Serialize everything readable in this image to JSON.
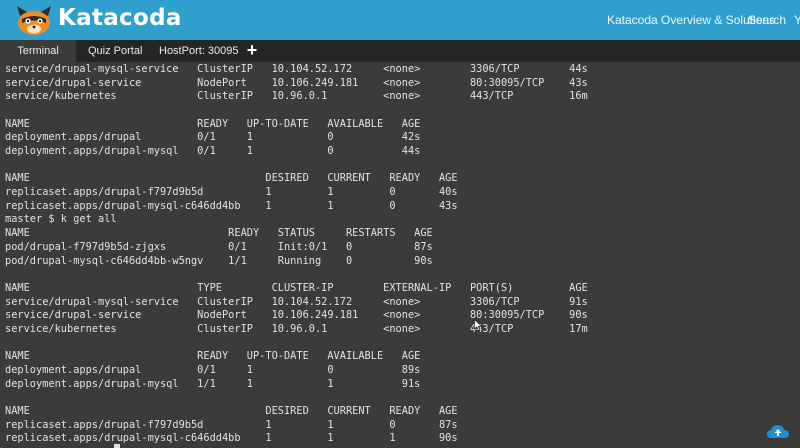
{
  "header": {
    "brand": "Katacoda",
    "nav": [
      {
        "label": "Katacoda Overview & Solutions"
      },
      {
        "label": "Search"
      },
      {
        "label": "Y"
      }
    ]
  },
  "tabs": {
    "items": [
      {
        "label": "Terminal",
        "active": true
      },
      {
        "label": "Quiz Portal",
        "active": false
      },
      {
        "label": "HostPort: 30095",
        "active": false
      }
    ],
    "add_label": "+"
  },
  "colors": {
    "header_bg": "#2fa0cd",
    "tabbar_bg": "#252525",
    "terminal_bg": "#3b3b39",
    "terminal_text": "#e2e2e2"
  },
  "icons": [
    "katacoda-logo-icon",
    "add-tab-icon",
    "mouse-pointer-icon",
    "cloud-upload-icon"
  ],
  "terminal": {
    "lines": [
      "service/drupal-mysql-service   ClusterIP   10.104.52.172     <none>        3306/TCP        44s",
      "service/drupal-service         NodePort    10.106.249.181    <none>        80:30095/TCP    43s",
      "service/kubernetes             ClusterIP   10.96.0.1         <none>        443/TCP         16m",
      "",
      "NAME                           READY   UP-TO-DATE   AVAILABLE   AGE",
      "deployment.apps/drupal         0/1     1            0           42s",
      "deployment.apps/drupal-mysql   0/1     1            0           44s",
      "",
      "NAME                                      DESIRED   CURRENT   READY   AGE",
      "replicaset.apps/drupal-f797d9b5d          1         1         0       40s",
      "replicaset.apps/drupal-mysql-c646dd4bb    1         1         0       43s",
      "master $ k get all",
      "NAME                                READY   STATUS     RESTARTS   AGE",
      "pod/drupal-f797d9b5d-zjgxs          0/1     Init:0/1   0          87s",
      "pod/drupal-mysql-c646dd4bb-w5ngv    1/1     Running    0          90s",
      "",
      "NAME                           TYPE        CLUSTER-IP        EXTERNAL-IP   PORT(S)         AGE",
      "service/drupal-mysql-service   ClusterIP   10.104.52.172     <none>        3306/TCP        91s",
      "service/drupal-service         NodePort    10.106.249.181    <none>        80:30095/TCP    90s",
      "service/kubernetes             ClusterIP   10.96.0.1         <none>        443/TCP         17m",
      "",
      "NAME                           READY   UP-TO-DATE   AVAILABLE   AGE",
      "deployment.apps/drupal         0/1     1            0           89s",
      "deployment.apps/drupal-mysql   1/1     1            1           91s",
      "",
      "NAME                                      DESIRED   CURRENT   READY   AGE",
      "replicaset.apps/drupal-f797d9b5d          1         1         0       87s",
      "replicaset.apps/drupal-mysql-c646dd4bb    1         1         1       90s"
    ]
  }
}
